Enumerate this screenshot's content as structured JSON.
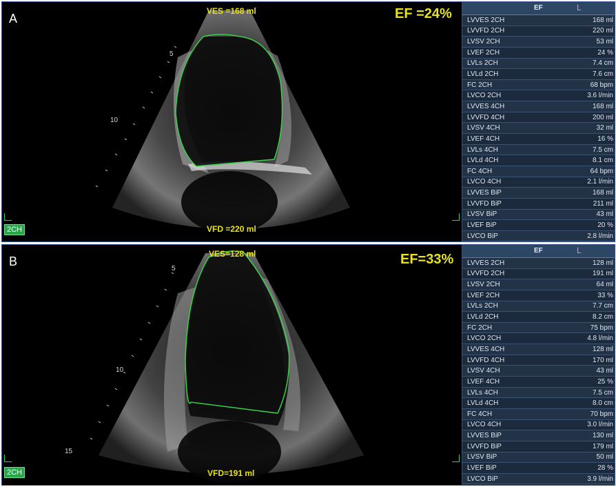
{
  "panels": [
    {
      "letter": "A",
      "ves_label": "VES =168 ml",
      "vfd_label": "VFD =220 ml",
      "ef_label": "EF =24%",
      "view_tag": "2CH",
      "depth_marks": [
        "5",
        "10"
      ],
      "table_header": "EF",
      "table_header_icon": "L",
      "rows": [
        {
          "name": "LVVES 2CH",
          "value": "168 ml"
        },
        {
          "name": "LVVFD 2CH",
          "value": "220 ml"
        },
        {
          "name": "LVSV 2CH",
          "value": "53 ml"
        },
        {
          "name": "LVEF 2CH",
          "value": "24 %"
        },
        {
          "name": "LVLs 2CH",
          "value": "7.4 cm"
        },
        {
          "name": "LVLd 2CH",
          "value": "7.6 cm"
        },
        {
          "name": "FC 2CH",
          "value": "68 bpm"
        },
        {
          "name": "LVCO 2CH",
          "value": "3.6 l/min"
        },
        {
          "name": "LVVES 4CH",
          "value": "168 ml"
        },
        {
          "name": "LVVFD 4CH",
          "value": "200 ml"
        },
        {
          "name": "LVSV 4CH",
          "value": "32 ml"
        },
        {
          "name": "LVEF 4CH",
          "value": "16 %"
        },
        {
          "name": "LVLs 4CH",
          "value": "7.5 cm"
        },
        {
          "name": "LVLd 4CH",
          "value": "8.1 cm"
        },
        {
          "name": "FC 4CH",
          "value": "64 bpm"
        },
        {
          "name": "LVCO 4CH",
          "value": "2.1 l/min"
        },
        {
          "name": "LVVES BiP",
          "value": "168 ml"
        },
        {
          "name": "LVVFD BiP",
          "value": "211 ml"
        },
        {
          "name": "LVSV BiP",
          "value": "43 ml"
        },
        {
          "name": "LVEF BiP",
          "value": "20 %"
        },
        {
          "name": "LVCO BiP",
          "value": "2.8 l/min"
        }
      ]
    },
    {
      "letter": "B",
      "ves_label": "VES=128 ml",
      "vfd_label": "VFD=191 ml",
      "ef_label": "EF=33%",
      "view_tag": "2CH",
      "depth_marks": [
        "5",
        "10",
        "15"
      ],
      "table_header": "EF",
      "table_header_icon": "L",
      "rows": [
        {
          "name": "LVVES 2CH",
          "value": "128 ml"
        },
        {
          "name": "LVVFD 2CH",
          "value": "191 ml"
        },
        {
          "name": "LVSV 2CH",
          "value": "64 ml"
        },
        {
          "name": "LVEF 2CH",
          "value": "33 %"
        },
        {
          "name": "LVLs 2CH",
          "value": "7.7 cm"
        },
        {
          "name": "LVLd 2CH",
          "value": "8.2 cm"
        },
        {
          "name": "FC 2CH",
          "value": "75 bpm"
        },
        {
          "name": "LVCO 2CH",
          "value": "4.8 l/min"
        },
        {
          "name": "LVVES 4CH",
          "value": "128 ml"
        },
        {
          "name": "LVVFD 4CH",
          "value": "170 ml"
        },
        {
          "name": "LVSV 4CH",
          "value": "43 ml"
        },
        {
          "name": "LVEF 4CH",
          "value": "25 %"
        },
        {
          "name": "LVLs 4CH",
          "value": "7.5 cm"
        },
        {
          "name": "LVLd 4CH",
          "value": "8.0 cm"
        },
        {
          "name": "FC 4CH",
          "value": "70 bpm"
        },
        {
          "name": "LVCO 4CH",
          "value": "3.0 l/min"
        },
        {
          "name": "LVVES BiP",
          "value": "130 ml"
        },
        {
          "name": "LVVFD BiP",
          "value": "179 ml"
        },
        {
          "name": "LVSV BiP",
          "value": "50 ml"
        },
        {
          "name": "LVEF BiP",
          "value": "28 %"
        },
        {
          "name": "LVCO BiP",
          "value": "3.9 l/min"
        }
      ]
    }
  ],
  "colors": {
    "overlay_text": "#e8e21c",
    "trace": "#39d24a",
    "table_bg": "#1d2c3f",
    "panel_border": "#2f4f86"
  }
}
